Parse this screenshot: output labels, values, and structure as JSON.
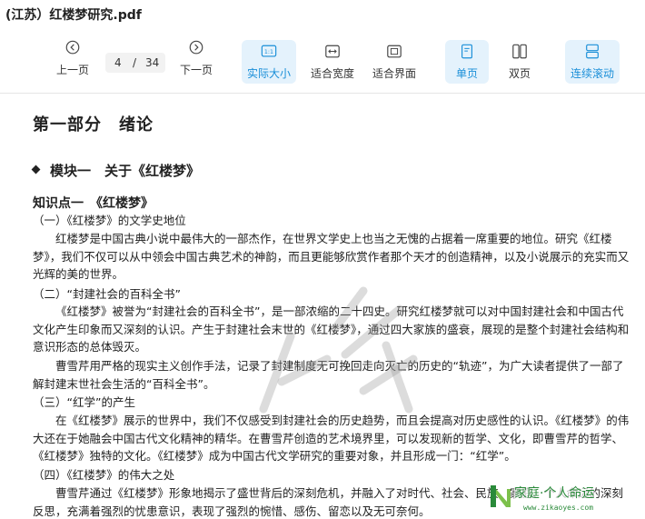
{
  "window": {
    "title": "(江苏）红楼梦研究.pdf"
  },
  "toolbar": {
    "prev_label": "上一页",
    "next_label": "下一页",
    "current_page": "4",
    "separator": "/",
    "total_pages": "34",
    "actual_size_label": "实际大小",
    "fit_width_label": "适合宽度",
    "fit_page_label": "适合界面",
    "single_page_label": "单页",
    "double_page_label": "双页",
    "continuous_label": "连续滚动",
    "accent_color": "#1a8fd8",
    "active_bg": "#e4f2fc"
  },
  "doc": {
    "part_title": "第一部分　绪论",
    "module_title": "模块一　关于《红楼梦》",
    "knowledge_point": "知识点一　《红楼梦》",
    "s1_title": "（一）《红楼梦》的文学史地位",
    "s1_p1": "红楼梦是中国古典小说中最伟大的一部杰作，在世界文学史上也当之无愧的占据着一席重要的地位。研究《红楼梦》，我们不仅可以从中领会中国古典艺术的神韵，而且更能够欣赏作者那个天才的创造精神，以及小说展示的充实而又光辉的美的世界。",
    "s2_title": "（二）“封建社会的百科全书”",
    "s2_p1": "《红楼梦》被誉为“封建社会的百科全书”，是一部浓缩的二十四史。研究红楼梦就可以对中国封建社会和中国古代文化产生印象而又深刻的认识。产生于封建社会末世的《红楼梦》，通过四大家族的盛衰，展现的是整个封建社会结构和意识形态的总体毁灭。",
    "s2_p2": "曹雪芹用严格的现实主义创作手法，记录了封建制度无可挽回走向灭亡的历史的“轨迹”，为广大读者提供了一部了解封建末世社会生活的“百科全书”。",
    "s3_title": "（三）“红学”的产生",
    "s3_p1": "在《红楼梦》展示的世界中，我们不仅感受到封建社会的历史趋势，而且会提高对历史感性的认识。《红楼梦》的伟大还在于她融会中国古代文化精神的精华。在曹雪芹创造的艺术境界里，可以发现新的哲学、文化，即曹雪芹的哲学、《红楼梦》独特的文化。《红楼梦》成为中国古代文学研究的重要对象，并且形成一门：“红学”。",
    "s4_title": "（四）《红楼梦》的伟大之处",
    "s4_p1": "曹雪芹通过《红楼梦》形象地揭示了盛世背后的深刻危机，并融入了对时代、社会、民族、家庭、个人命运的深刻反思，充满着强烈的忧患意识，表现了强烈的惋惜、感伤、留恋以及无可奈何。"
  },
  "watermark": {
    "tag": "家庭·个人命运",
    "url": "www.zikaoyes.com"
  }
}
